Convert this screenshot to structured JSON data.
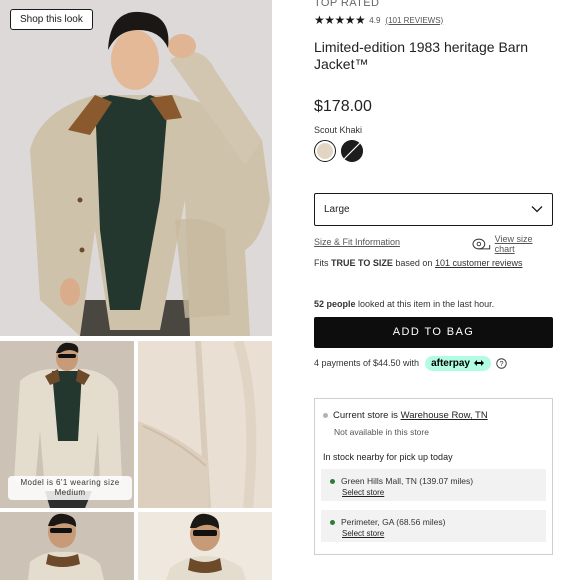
{
  "gallery": {
    "shop_look_label": "Shop this look",
    "model_note": "Model is 6'1 wearing size Medium",
    "favorite_icon": "heart-outline-icon"
  },
  "product": {
    "badge": "TOP RATED",
    "rating": {
      "stars_text": "★★★★★",
      "value": "4.9",
      "reviews_link": "(101 REVIEWS)",
      "stars_filled": 5,
      "stars_max": 5
    },
    "title": "Limited-edition 1983 heritage Barn Jacket™",
    "price": "$178.00",
    "color_name": "Scout Khaki",
    "swatches": [
      {
        "name": "Scout Khaki",
        "color": "#e2d5c3",
        "selected": true
      },
      {
        "name": "Black",
        "color": "#1d1d1d",
        "selected": false
      }
    ],
    "size_select": {
      "value": "Large",
      "icon": "chevron-down-icon"
    },
    "size_fit_link": "Size & Fit Information",
    "size_chart_link": "View size chart",
    "fit": {
      "prefix": "Fits",
      "strong": "TRUE TO SIZE",
      "middle": "based on",
      "link": "101 customer reviews"
    },
    "views": {
      "strong": "52 people",
      "rest": "looked at this item in the last hour."
    },
    "add_to_bag": "ADD TO BAG",
    "payment": {
      "text": "4 payments of $44.50 with",
      "provider": "afterpay",
      "provider_color": "#b2fce4"
    }
  },
  "store": {
    "current_prefix": "Current store is",
    "current_store_link": "Warehouse Row, TN",
    "current_status": "Not available in this store",
    "current_dot_color": "#b3b3b3",
    "nearby_title": "In stock nearby for pick up today",
    "nearby": [
      {
        "name": "Green Hills Mall, TN (139.07 miles)",
        "action": "Select store",
        "dot_color": "#2e7d32"
      },
      {
        "name": "Perimeter, GA (68.56 miles)",
        "action": "Select store",
        "dot_color": "#2e7d32"
      }
    ]
  }
}
